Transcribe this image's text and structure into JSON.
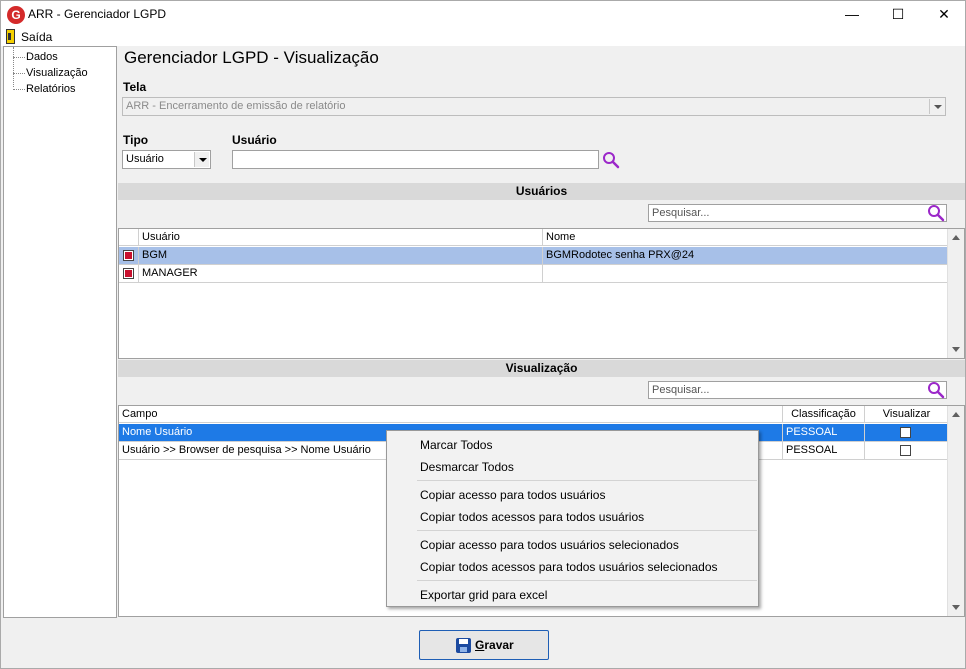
{
  "window": {
    "title": "ARR - Gerenciador LGPD",
    "app_icon_letter": "G",
    "minimize_glyph": "—",
    "maximize_glyph": "☐",
    "close_glyph": "✕"
  },
  "menu": {
    "exit_label": "Saída"
  },
  "tree": {
    "items": [
      {
        "label": "Dados"
      },
      {
        "label": "Visualização"
      },
      {
        "label": "Relatórios"
      }
    ]
  },
  "page": {
    "title": "Gerenciador LGPD - Visualização"
  },
  "tela": {
    "label": "Tela",
    "value": "ARR - Encerramento de emissão de relatório"
  },
  "tipo": {
    "label": "Tipo",
    "value": "Usuário"
  },
  "usuario": {
    "label": "Usuário",
    "value": ""
  },
  "users_section": {
    "title": "Usuários",
    "search_placeholder": "Pesquisar...",
    "columns": [
      "Usuário",
      "Nome"
    ],
    "rows": [
      {
        "usuario": "BGM",
        "nome": "BGMRodotec senha PRX@24",
        "checked": true
      },
      {
        "usuario": "MANAGER",
        "nome": "",
        "checked": true
      }
    ]
  },
  "view_section": {
    "title": "Visualização",
    "search_placeholder": "Pesquisar...",
    "columns": [
      "Campo",
      "Classificação",
      "Visualizar"
    ],
    "rows": [
      {
        "campo": "Nome Usuário",
        "classificacao": "PESSOAL",
        "visualizar": false
      },
      {
        "campo": "Usuário >> Browser de pesquisa >> Nome Usuário",
        "classificacao": "PESSOAL",
        "visualizar": false
      }
    ]
  },
  "context_menu": {
    "items": [
      "Marcar Todos",
      "Desmarcar Todos",
      "Copiar acesso para todos usuários",
      "Copiar todos acessos para todos usuários",
      "Copiar acesso para todos usuários selecionados",
      "Copiar todos acessos para todos usuários selecionados",
      "Exportar grid para excel"
    ]
  },
  "save_button": {
    "mnemonic": "G",
    "rest": "ravar"
  },
  "colors": {
    "accent": "#1e7ae6",
    "selection_light": "#a7c0e8",
    "check_red": "#c8102e",
    "search_icon": "#9b27c9"
  },
  "icons": {
    "search": "search-icon",
    "save": "floppy-disk-icon",
    "exit": "exit-door-icon"
  }
}
